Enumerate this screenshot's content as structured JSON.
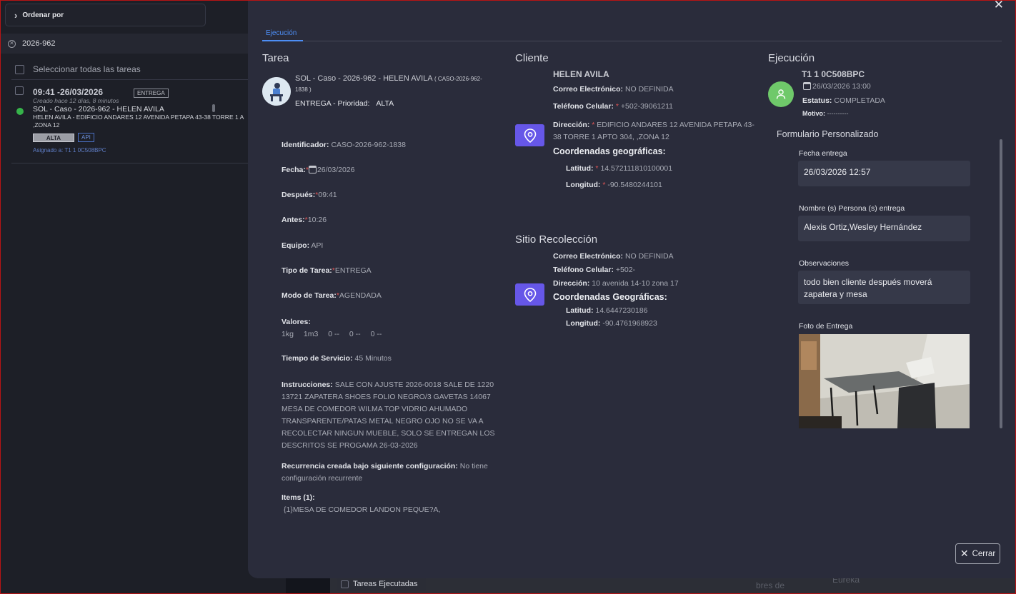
{
  "left": {
    "sort_label": "Ordenar por",
    "search_value": "2026-962",
    "select_all": "Seleccionar todas las tareas",
    "task": {
      "time": "09:41 -26/03/2026",
      "type_badge": "ENTREGA",
      "created": "Creado hace 12 días, 8 minutos",
      "title": "SOL - Caso - 2026-962 - HELEN AVILA",
      "address_line1": "HELEN AVILA - EDIFICIO ANDARES 12 AVENIDA PETAPA 43-38 TORRE 1 A",
      "address_line2": ",ZONA 12",
      "priority": "ALTA",
      "team": "API",
      "assigned": "Asignado a: T1 1 0C508BPC"
    }
  },
  "map": {
    "executed_checkbox": "Tareas Ejecutadas",
    "label_a": "bres de",
    "label_b": "Eureka"
  },
  "modal": {
    "tab": "Ejecución",
    "close_label": "Cerrar",
    "tarea": {
      "heading": "Tarea",
      "title": "SOL - Caso - 2026-962 - HELEN AVILA",
      "code": "( CASO-2026-962-1838 )",
      "type_prio_label": "ENTREGA - Prioridad:",
      "priority": "ALTA",
      "identificador_label": "Identificador:",
      "identificador": "CASO-2026-962-1838",
      "fecha_label": "Fecha:",
      "fecha": "26/03/2026",
      "despues_label": "Después:",
      "despues": "09:41",
      "antes_label": "Antes:",
      "antes": "10:26",
      "equipo_label": "Equipo:",
      "equipo": "API",
      "tipo_label": "Tipo de Tarea:",
      "tipo": "ENTREGA",
      "modo_label": "Modo de Tarea:",
      "modo": "AGENDADA",
      "valores_label": "Valores:",
      "valores": [
        "1kg",
        "1m3",
        "0 --",
        "0 --",
        "0 --"
      ],
      "tiempo_label": "Tiempo de Servicio:",
      "tiempo": "45 Minutos",
      "instr_label": "Instrucciones:",
      "instr_first": "SALE CON AJUSTE 2026-0018 SALE DE 1220",
      "instr_lines": [
        "13721 ZAPATERA SHOES FOLIO NEGRO/3 GAVETAS 14067",
        "MESA DE COMEDOR WILMA TOP VIDRIO AHUMADO",
        "TRANSPARENTE/PATAS METAL NEGRO OJO NO SE VA A",
        "RECOLECTAR NINGUN MUEBLE, SOLO SE ENTREGAN LOS",
        "DESCRITOS SE PROGAMA 26-03-2026"
      ],
      "recur_label": "Recurrencia creada bajo siguiente configuración:",
      "recur_a": "No tiene",
      "recur_b": "configuración recurrente",
      "items_label": "Items (1):",
      "item": "{1}MESA DE COMEDOR LANDON PEQUE?A,"
    },
    "cliente": {
      "heading": "Cliente",
      "name": "HELEN AVILA",
      "email_label": "Correo Electrónico:",
      "email": "NO DEFINIDA",
      "phone_label": "Teléfono Celular:",
      "phone": "+502-39061211",
      "dir_label": "Dirección:",
      "dir_a": "EDIFICIO ANDARES 12 AVENIDA PETAPA 43-",
      "dir_b": "38 TORRE 1 APTO 304, ,ZONA 12",
      "coords_label": "Coordenadas geográficas:",
      "lat_label": "Latitud:",
      "lat": "14.572111810100001",
      "lng_label": "Longitud:",
      "lng": "-90.5480244101"
    },
    "sitio": {
      "heading": "Sitio Recolección",
      "email_label": "Correo Electrónico:",
      "email": "NO DEFINIDA",
      "phone_label": "Teléfono Celular:",
      "phone": "+502-",
      "dir_label": "Dirección:",
      "dir": "10 avenida 14-10 zona 17",
      "coords_label": "Coordenadas Geográficas:",
      "lat_label": "Latitud:",
      "lat": "14.6447230186",
      "lng_label": "Longitud:",
      "lng": "-90.4761968923"
    },
    "ejecucion": {
      "heading": "Ejecución",
      "driver": "T1 1 0C508BPC",
      "datetime": "26/03/2026 13:00",
      "estatus_label": "Estatus:",
      "estatus": "COMPLETADA",
      "motivo_label": "Motivo:",
      "motivo": "----------",
      "form_heading": "Formulario Personalizado",
      "fecha_entrega_label": "Fecha entrega",
      "fecha_entrega": "26/03/2026 12:57",
      "persona_label": "Nombre (s) Persona (s) entrega",
      "persona": "Alexis Ortiz,Wesley Hernández",
      "obs_label": "Observaciones",
      "obs": "todo bien cliente después moverá zapatera y mesa",
      "foto_label": "Foto de Entrega"
    }
  },
  "colors": {
    "accent": "#4d8ef5",
    "pin": "#6657e8",
    "required": "#e05555",
    "status_green": "#36b34a"
  }
}
